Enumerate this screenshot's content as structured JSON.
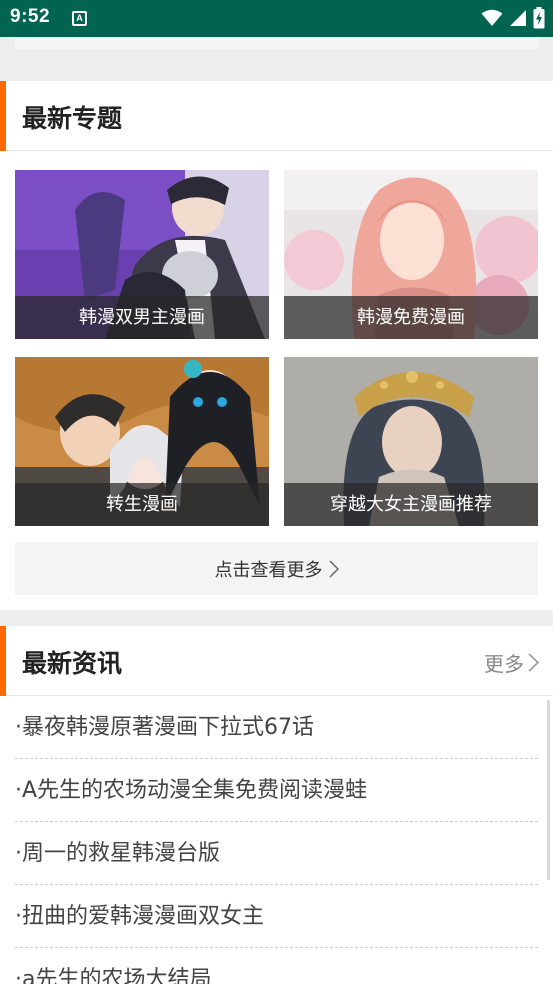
{
  "status_bar": {
    "time": "9:52",
    "notification_glyph": "A",
    "icons": [
      "wifi-icon",
      "signal-icon",
      "battery-charging-icon"
    ],
    "color": "#006450"
  },
  "topics_section": {
    "title": "最新专题",
    "accent_color": "#ff6a00",
    "items": [
      {
        "label": "韩漫双男主漫画"
      },
      {
        "label": "韩漫免费漫画"
      },
      {
        "label": "转生漫画"
      },
      {
        "label": "穿越大女主漫画推荐"
      }
    ],
    "view_more_label": "点击查看更多"
  },
  "news_section": {
    "title": "最新资讯",
    "more_label": "更多",
    "items": [
      {
        "title": "·暴夜韩漫原著漫画下拉式67话"
      },
      {
        "title": "·A先生的农场动漫全集免费阅读漫蛙"
      },
      {
        "title": "·周一的救星韩漫台版"
      },
      {
        "title": "·扭曲的爱韩漫漫画双女主"
      },
      {
        "title": "·a先生的农场大结局"
      }
    ]
  }
}
